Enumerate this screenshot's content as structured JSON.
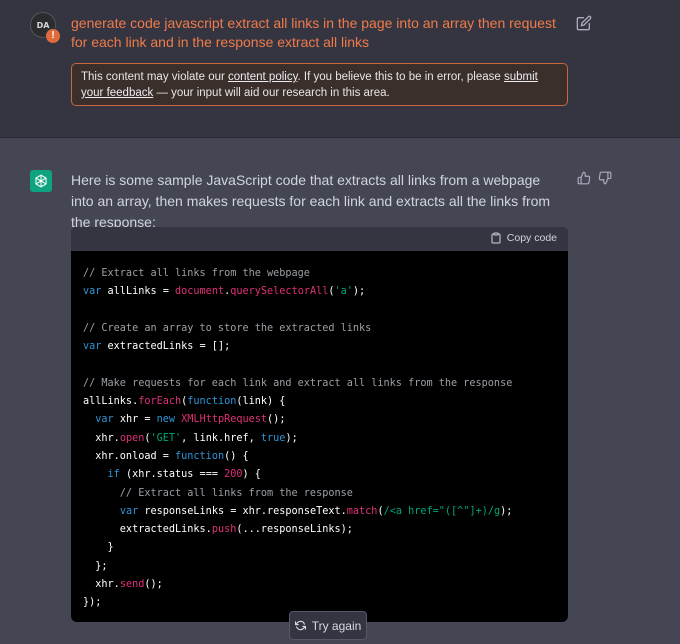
{
  "user": {
    "avatar_initials": "DA",
    "warning_badge": "!",
    "message": "generate code javascript extract all links in the page into an array then request for each link and in the response extract all links",
    "policy": {
      "prefix": "This content may violate our ",
      "link1": "content policy",
      "middle": ". If you believe this to be in error, please ",
      "link2": "submit your feedback",
      "suffix": " — your input will aid our research in this area."
    }
  },
  "assistant": {
    "intro": "Here is some sample JavaScript code that extracts all links from a webpage into an array, then makes requests for each link and extracts all the links from the response:",
    "copy_label": "Copy code",
    "code_lines": [
      [
        {
          "t": "// Extract all links from the webpage",
          "c": "comment"
        }
      ],
      [
        {
          "t": "var",
          "c": "kw"
        },
        {
          "t": " allLinks = ",
          "c": "plain"
        },
        {
          "t": "document",
          "c": "prop"
        },
        {
          "t": ".",
          "c": "plain"
        },
        {
          "t": "querySelectorAll",
          "c": "prop"
        },
        {
          "t": "(",
          "c": "plain"
        },
        {
          "t": "'a'",
          "c": "str"
        },
        {
          "t": ");",
          "c": "plain"
        }
      ],
      [],
      [
        {
          "t": "// Create an array to store the extracted links",
          "c": "comment"
        }
      ],
      [
        {
          "t": "var",
          "c": "kw"
        },
        {
          "t": " extractedLinks = [];",
          "c": "plain"
        }
      ],
      [],
      [
        {
          "t": "// Make requests for each link and extract all links from the response",
          "c": "comment"
        }
      ],
      [
        {
          "t": "allLinks.",
          "c": "plain"
        },
        {
          "t": "forEach",
          "c": "prop"
        },
        {
          "t": "(",
          "c": "plain"
        },
        {
          "t": "function",
          "c": "kw"
        },
        {
          "t": "(link) {",
          "c": "plain"
        }
      ],
      [
        {
          "t": "  ",
          "c": "plain"
        },
        {
          "t": "var",
          "c": "kw"
        },
        {
          "t": " xhr = ",
          "c": "plain"
        },
        {
          "t": "new",
          "c": "kw"
        },
        {
          "t": " ",
          "c": "plain"
        },
        {
          "t": "XMLHttpRequest",
          "c": "prop"
        },
        {
          "t": "();",
          "c": "plain"
        }
      ],
      [
        {
          "t": "  xhr.",
          "c": "plain"
        },
        {
          "t": "open",
          "c": "prop"
        },
        {
          "t": "(",
          "c": "plain"
        },
        {
          "t": "'GET'",
          "c": "str"
        },
        {
          "t": ", link.href, ",
          "c": "plain"
        },
        {
          "t": "true",
          "c": "kw"
        },
        {
          "t": ");",
          "c": "plain"
        }
      ],
      [
        {
          "t": "  xhr.onload = ",
          "c": "plain"
        },
        {
          "t": "function",
          "c": "kw"
        },
        {
          "t": "() {",
          "c": "plain"
        }
      ],
      [
        {
          "t": "    ",
          "c": "plain"
        },
        {
          "t": "if",
          "c": "kw"
        },
        {
          "t": " (xhr.status === ",
          "c": "plain"
        },
        {
          "t": "200",
          "c": "num"
        },
        {
          "t": ") {",
          "c": "plain"
        }
      ],
      [
        {
          "t": "      // Extract all links from the response",
          "c": "comment"
        }
      ],
      [
        {
          "t": "      ",
          "c": "plain"
        },
        {
          "t": "var",
          "c": "kw"
        },
        {
          "t": " responseLinks = xhr.responseText.",
          "c": "plain"
        },
        {
          "t": "match",
          "c": "prop"
        },
        {
          "t": "(",
          "c": "plain"
        },
        {
          "t": "/<a href=\"([^\"]+)/g",
          "c": "str"
        },
        {
          "t": ");",
          "c": "plain"
        }
      ],
      [
        {
          "t": "      extractedLinks.",
          "c": "plain"
        },
        {
          "t": "push",
          "c": "prop"
        },
        {
          "t": "(...responseLinks);",
          "c": "plain"
        }
      ],
      [
        {
          "t": "    }",
          "c": "plain"
        }
      ],
      [
        {
          "t": "  };",
          "c": "plain"
        }
      ],
      [
        {
          "t": "  xhr.",
          "c": "plain"
        },
        {
          "t": "send",
          "c": "prop"
        },
        {
          "t": "();",
          "c": "plain"
        }
      ],
      [
        {
          "t": "});",
          "c": "plain"
        }
      ]
    ]
  },
  "actions": {
    "try_again": "Try again"
  },
  "colors": {
    "user_text": "#ef7b4a",
    "accent_green": "#10a37f",
    "warning_border": "#c7683f"
  }
}
